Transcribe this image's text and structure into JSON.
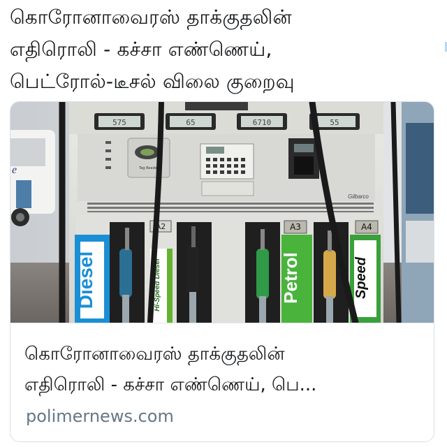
{
  "tweet": {
    "text_lines": [
      "கொரோனாவைரஸ் தாக்குதலின்",
      "எதிரொலி - கச்சா எண்ணெய்,",
      "பெட்ரோல்-டீசல் விலை குறைவு"
    ]
  },
  "card": {
    "image": {
      "pumps": [
        {
          "nozzle_label": "A2",
          "brand_text": "Diesel",
          "color": "#1b8fd6"
        },
        {
          "nozzle_label": "",
          "brand_text": "Hi-Speed Diesel",
          "color": "#64b32e"
        },
        {
          "nozzle_label": "A3",
          "brand_text": "Petrol",
          "color": "#49b33c"
        },
        {
          "nozzle_label": "A4",
          "brand_text": "Speed",
          "color": "#3aa03a"
        }
      ],
      "display_readouts": [
        "575",
        "65",
        "6710",
        "55"
      ],
      "manufacturer_text": "Gilbarco",
      "pad_label": "Tag Reader"
    },
    "title_lines": [
      "கொரோனாவைரஸ் தாக்குதலின்",
      "எதிரொலி - கச்சா எண்ணெய், பெ..."
    ],
    "domain": "polimernews.com"
  },
  "colors": {
    "text": "#14171a",
    "muted": "#657786",
    "border": "#d9e0e6",
    "diesel_blue": "#1b8fd6",
    "petrol_green": "#49b33c"
  }
}
